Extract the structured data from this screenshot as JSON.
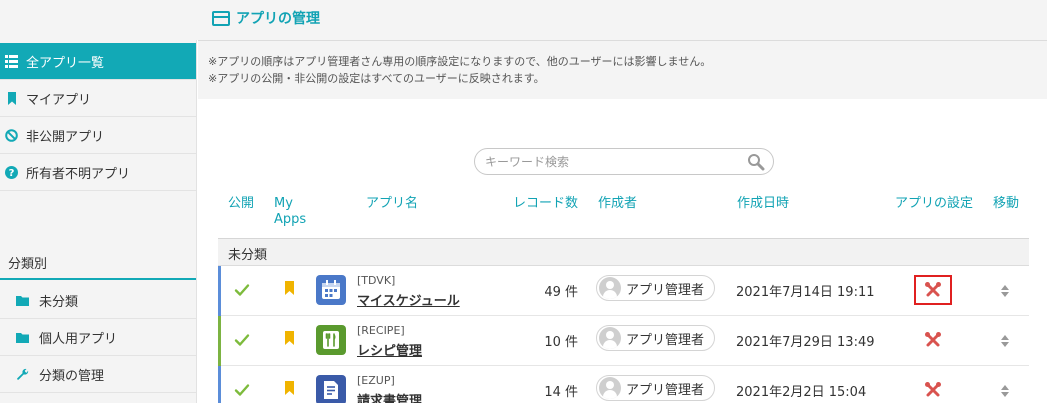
{
  "header": {
    "title": "アプリの管理"
  },
  "sidebar": {
    "items": [
      {
        "label": "全アプリ一覧",
        "icon": "grid-list-icon"
      },
      {
        "label": "マイアプリ",
        "icon": "bookmark-icon"
      },
      {
        "label": "非公開アプリ",
        "icon": "prohibited-icon"
      },
      {
        "label": "所有者不明アプリ",
        "icon": "question-circle-icon"
      }
    ],
    "section_label": "分類別",
    "categories": [
      {
        "label": "未分類",
        "icon": "folder-icon"
      },
      {
        "label": "個人用アプリ",
        "icon": "folder-icon"
      },
      {
        "label": "分類の管理",
        "icon": "wrench-icon"
      }
    ]
  },
  "notice": {
    "line1": "※アプリの順序はアプリ管理者さん専用の順序設定になりますので、他のユーザーには影響しません。",
    "line2": "※アプリの公開・非公開の設定はすべてのユーザーに反映されます。"
  },
  "search": {
    "placeholder": "キーワード検索"
  },
  "table": {
    "headers": {
      "public": "公開",
      "myapps_line1": "My",
      "myapps_line2": "Apps",
      "name": "アプリ名",
      "records": "レコード数",
      "creator": "作成者",
      "created": "作成日時",
      "settings": "アプリの設定",
      "move": "移動"
    },
    "group": "未分類",
    "rows": [
      {
        "code": "[TDVK]",
        "name": "マイスケジュール",
        "count": "49 件",
        "creator": "アプリ管理者",
        "date": "2021年7月14日 19:11"
      },
      {
        "code": "[RECIPE]",
        "name": "レシピ管理",
        "count": "10 件",
        "creator": "アプリ管理者",
        "date": "2021年7月29日 13:49"
      },
      {
        "code": "[EZUP]",
        "name": "請求書管理",
        "count": "14 件",
        "creator": "アプリ管理者",
        "date": "2021年2月2日 15:04"
      }
    ]
  },
  "colors": {
    "accent": "#12a9b6",
    "check": "#7dbb3c",
    "bookmark": "#f0b400",
    "tools": "#d9534f",
    "highlight": "#e02020",
    "row_bar_blue": "#5b8dd9",
    "row_bar_green": "#7cb342"
  }
}
